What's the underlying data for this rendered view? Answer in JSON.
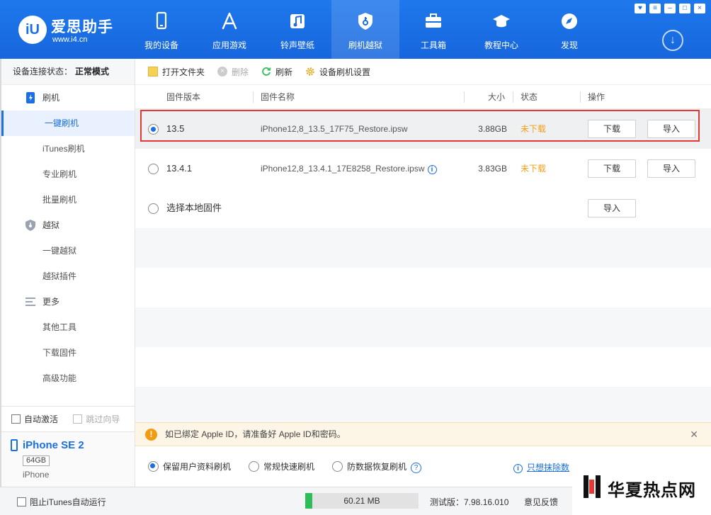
{
  "app": {
    "logo_badge": "iU",
    "logo_title": "爱思助手",
    "logo_url": "www.i4.cn"
  },
  "nav": [
    {
      "label": "我的设备",
      "icon": "phone-icon"
    },
    {
      "label": "应用游戏",
      "icon": "appstore-icon"
    },
    {
      "label": "铃声壁纸",
      "icon": "music-icon"
    },
    {
      "label": "刷机越狱",
      "icon": "shield-key-icon",
      "active": true
    },
    {
      "label": "工具箱",
      "icon": "toolbox-icon"
    },
    {
      "label": "教程中心",
      "icon": "graduation-cap-icon"
    },
    {
      "label": "发现",
      "icon": "compass-icon"
    }
  ],
  "sidebar": {
    "conn_label": "设备连接状态：",
    "conn_value": "正常模式",
    "groups": {
      "flash": "刷机",
      "jailbreak": "越狱",
      "more": "更多"
    },
    "items": {
      "one_click_flash": "一键刷机",
      "itunes_flash": "iTunes刷机",
      "pro_flash": "专业刷机",
      "batch_flash": "批量刷机",
      "one_click_jb": "一键越狱",
      "jb_plugins": "越狱插件",
      "other_tools": "其他工具",
      "download_fw": "下载固件",
      "advanced": "高级功能"
    },
    "auto_activate": "自动激活",
    "skip_guide": "跳过向导",
    "device_name": "iPhone SE 2",
    "device_capacity": "64GB",
    "device_model": "iPhone"
  },
  "toolbar": {
    "open_folder": "打开文件夹",
    "delete": "删除",
    "refresh": "刷新",
    "settings": "设备刷机设置"
  },
  "table": {
    "headers": {
      "version": "固件版本",
      "name": "固件名称",
      "size": "大小",
      "status": "状态",
      "action": "操作"
    },
    "rows": [
      {
        "version": "13.5",
        "name": "iPhone12,8_13.5_17F75_Restore.ipsw",
        "size": "3.88GB",
        "status": "未下载",
        "download": "下载",
        "import": "导入"
      },
      {
        "version": "13.4.1",
        "name": "iPhone12,8_13.4.1_17E8258_Restore.ipsw",
        "size": "3.83GB",
        "status": "未下载",
        "download": "下载",
        "import": "导入"
      },
      {
        "version": "选择本地固件",
        "import": "导入"
      }
    ]
  },
  "notice": {
    "text": "如已绑定 Apple ID，请准备好 Apple ID和密码。"
  },
  "modes": {
    "keep_data": "保留用户资料刷机",
    "quick": "常规快速刷机",
    "anti_recovery": "防数据恢复刷机",
    "erase_link": "只想抹除数"
  },
  "statusbar": {
    "block_itunes": "阻止iTunes自动运行",
    "memory": "60.21 MB",
    "memory_fill": 0.06,
    "version": "测试版：7.98.16.010",
    "feedback": "意见反馈"
  },
  "watermark": {
    "text": "华夏热点网"
  },
  "colors": {
    "accent": "#1a6fe6",
    "status_warning": "#f0a01a",
    "highlight": "#e53935"
  }
}
